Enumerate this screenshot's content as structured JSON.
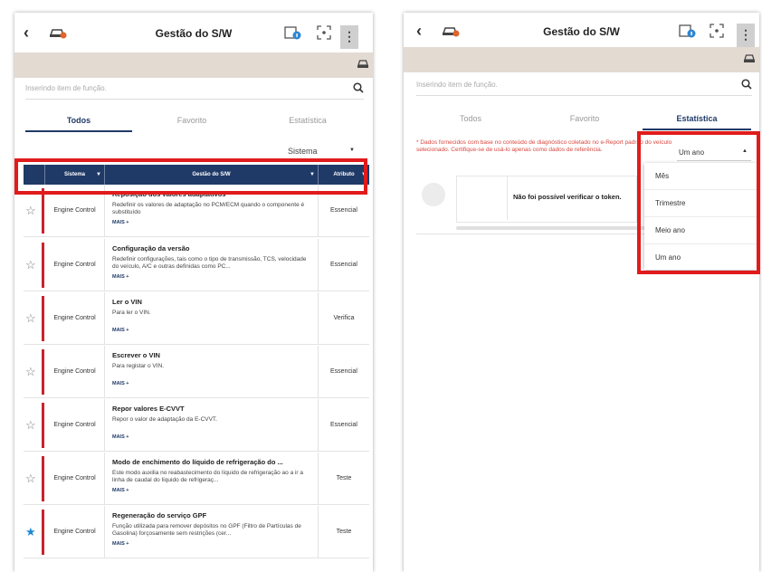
{
  "left": {
    "title": "Gestão do S/W",
    "search_placeholder": "Inserindo item de função.",
    "tabs": [
      "Todos",
      "Favorito",
      "Estatística"
    ],
    "active_tab": "Todos",
    "filter_value": "Sistema",
    "columns": [
      "Sistema",
      "Gestão do S/W",
      "Atributo"
    ],
    "more_label": "MAIS +",
    "rows": [
      {
        "system": "Engine Control",
        "name": "Reposição dos valores adaptativos",
        "desc": "Redefinir os valores de adaptação no PCM/ECM quando o componente é substituído",
        "attr": "Essencial",
        "favorite": false
      },
      {
        "system": "Engine Control",
        "name": "Configuração da versão",
        "desc": "Redefinir configurações, tais como o tipo de transmissão, TCS, velocidade do veículo, A/C e outras definidas como PC...",
        "attr": "Essencial",
        "favorite": false
      },
      {
        "system": "Engine Control",
        "name": "Ler o VIN",
        "desc": "Para ler o VIN.",
        "attr": "Verifica",
        "favorite": false
      },
      {
        "system": "Engine Control",
        "name": "Escrever o VIN",
        "desc": "Para registar o VIN.",
        "attr": "Essencial",
        "favorite": false
      },
      {
        "system": "Engine Control",
        "name": "Repor valores E-CVVT",
        "desc": "Repor o valor de adaptação da E-CVVT.",
        "attr": "Essencial",
        "favorite": false
      },
      {
        "system": "Engine Control",
        "name": "Modo de enchimento do líquido de refrigeração do ...",
        "desc": "Este modo auxilia no reabastecimento do líquido de refrigeração ao a ir a linha de caudal do líquido de refrigeraç...",
        "attr": "Teste",
        "favorite": false
      },
      {
        "system": "Engine Control",
        "name": "Regeneração do serviço GPF",
        "desc": "Função utilizada para remover depósitos no GPF (Filtro de Partículas de Gasolina) forçosamente sem restrições (cer...",
        "attr": "Teste",
        "favorite": true
      }
    ]
  },
  "right": {
    "title": "Gestão do S/W",
    "search_placeholder": "Inserindo item de função.",
    "tabs": [
      "Todos",
      "Favorito",
      "Estatística"
    ],
    "active_tab": "Estatística",
    "notice": "* Dados fornecidos com base no conteúdo de diagnóstico coletado no e-Report padrão do veículo selecionado. Certifique-se de usá-lo apenas como dados de referência.",
    "period_value": "Um ano",
    "token_message": "Não foi possível verificar o token.",
    "period_options": [
      "Mês",
      "Trimestre",
      "Meio ano",
      "Um ano"
    ]
  },
  "colors": {
    "accent": "#1f3a67",
    "highlight": "#e11b1b",
    "row_bar": "#c8232c",
    "favorite": "#1e88d4",
    "banner": "#e3dad2"
  },
  "icons": [
    "back-arrow-icon",
    "car-fault-icon",
    "info-icon",
    "scan-icon",
    "more-vertical-icon",
    "vehicle-icon",
    "search-icon",
    "star-icon",
    "caret-down-icon",
    "caret-up-icon"
  ]
}
